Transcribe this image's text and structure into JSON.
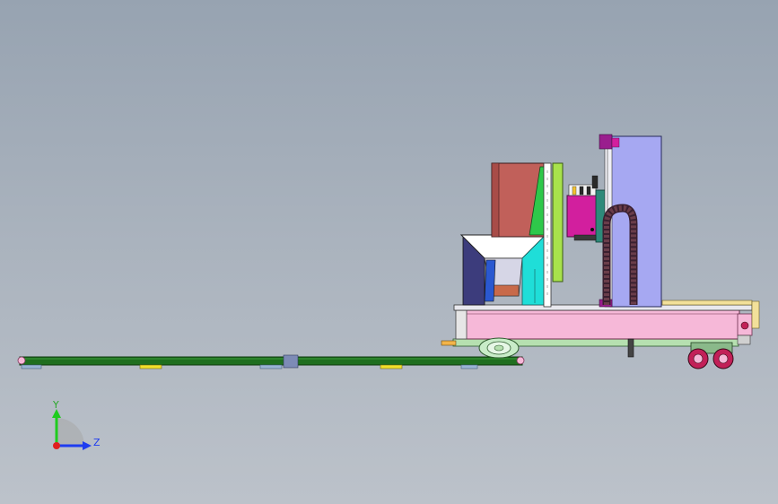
{
  "viewport": {
    "background_top": "#97a3b1",
    "background_bottom": "#bcc2ca"
  },
  "model": {
    "colors": {
      "track": "#1f6e1f",
      "base_frame": "#f6b8d8",
      "pink_panel": "#c1605a",
      "hopper": "#1fded8",
      "purple_column": "#a6a8f2",
      "magenta": "#d21f9e",
      "lime": "#a8e24c",
      "drag_chain": "#6a3d4a",
      "wheel": "#c22058"
    }
  },
  "triad": {
    "y_label": "Y",
    "z_label": "Z",
    "y_color": "#1ecc1e",
    "z_color": "#1e3cf0",
    "x_color": "#e01e1e"
  }
}
